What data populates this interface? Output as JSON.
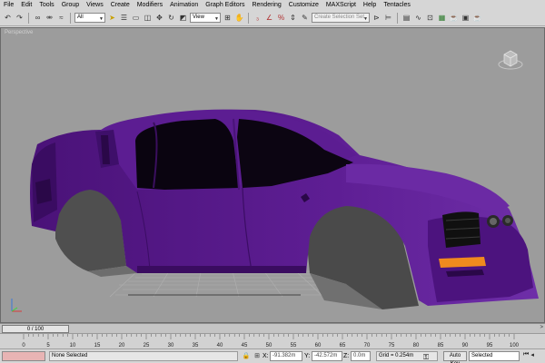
{
  "menubar": {
    "items": [
      "File",
      "Edit",
      "Tools",
      "Group",
      "Views",
      "Create",
      "Modifiers",
      "Animation",
      "Graph Editors",
      "Rendering",
      "Customize",
      "MAXScript",
      "Help",
      "Tentacles"
    ]
  },
  "toolbar": {
    "selection_filter": "All",
    "reference_coord": "View",
    "named_selection_placeholder": "Create Selection Set",
    "icons": [
      "undo-icon",
      "redo-icon",
      "link-icon",
      "unlink-icon",
      "bind-space-warp-icon",
      "select-object-icon",
      "select-by-name-icon",
      "rectangular-selection-icon",
      "window-crossing-icon",
      "select-move-icon",
      "select-rotate-icon",
      "select-scale-icon",
      "pivot-icon",
      "manipulate-icon",
      "snap-toggle-icon",
      "angle-snap-icon",
      "percent-snap-icon",
      "spinner-snap-icon",
      "mirror-icon",
      "align-icon",
      "layer-manager-icon",
      "curve-editor-icon",
      "schematic-view-icon",
      "material-editor-icon",
      "render-setup-icon",
      "render-frame-icon",
      "quick-render-icon"
    ]
  },
  "viewport": {
    "label": "Perspective",
    "background": "#9c9c9c",
    "car_color": "#5a1c8e"
  },
  "timeslider": {
    "frame_display": "0 / 100",
    "left_arrow": "<",
    "right_arrow": ">"
  },
  "trackbar": {
    "ticks": [
      "0",
      "5",
      "10",
      "15",
      "20",
      "25",
      "30",
      "35",
      "40",
      "45",
      "50",
      "55",
      "60",
      "65",
      "70",
      "75",
      "80",
      "85",
      "90",
      "95",
      "100"
    ]
  },
  "statusbar": {
    "selection_text": "None Selected",
    "x_label": "X:",
    "x_value": "-91.382m",
    "y_label": "Y:",
    "y_value": "-42.572m",
    "z_label": "Z:",
    "z_value": "0.0m",
    "grid_text": "Grid = 0.254m",
    "autokey_label": "Auto Key",
    "selected_label": "Selected"
  }
}
